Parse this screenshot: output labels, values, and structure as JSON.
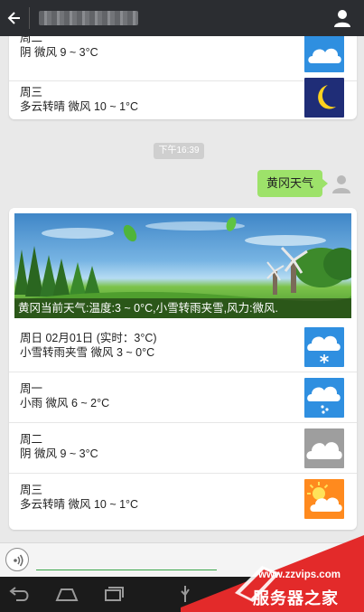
{
  "header": {
    "back_icon": "back-arrow-icon",
    "profile_icon": "person-icon"
  },
  "top_card": {
    "rows": [
      {
        "day": "周二",
        "desc": "阴 微风 9 ~ 3°C",
        "icon": "cloudy-icon"
      },
      {
        "day": "周三",
        "desc": "多云转晴 微风 10 ~ 1°C",
        "icon": "moon-icon"
      }
    ]
  },
  "timestamp": "下午16:39",
  "outgoing_message": "黄冈天气",
  "weather_card": {
    "banner_caption": "黄冈当前天气:温度:3 ~ 0°C,小雪转雨夹雪,风力:微风.",
    "rows": [
      {
        "day": "周日 02月01日 (实时：3°C)",
        "desc": "小雪转雨夹雪 微风 3 ~ 0°C",
        "icon": "snow-icon"
      },
      {
        "day": "周一",
        "desc": "小雨 微风 6 ~ 2°C",
        "icon": "light-rain-icon"
      },
      {
        "day": "周二",
        "desc": "阴 微风 9 ~ 3°C",
        "icon": "cloudy-icon"
      },
      {
        "day": "周三",
        "desc": "多云转晴 微风 10 ~ 1°C",
        "icon": "partly-sunny-icon"
      }
    ]
  },
  "watermark": {
    "url": "www.zzvips.com",
    "brand": "服务器之家"
  },
  "colors": {
    "title_bar": "#2b2d31",
    "bubble": "#9de26a",
    "sky_blue": "#2f8fe0",
    "cloud_gray": "#9e9e9e",
    "moon_bg": "#1f2d77",
    "sun_bg": "#ff8a1e",
    "watermark_red": "#e32a2a"
  }
}
